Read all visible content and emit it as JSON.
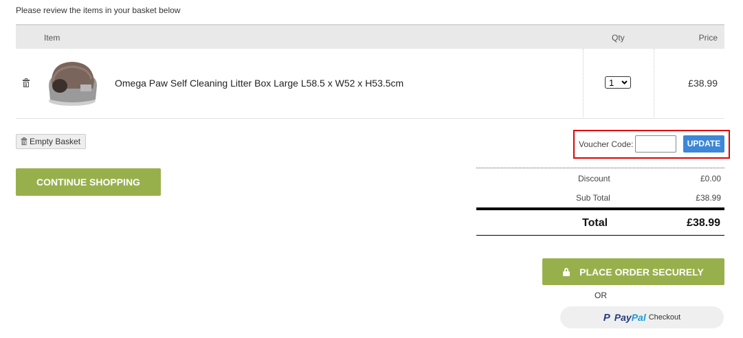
{
  "intro_text": "Please review the items in your basket below",
  "table": {
    "headers": {
      "item": "Item",
      "qty": "Qty",
      "price": "Price"
    },
    "rows": [
      {
        "name": "Omega Paw Self Cleaning Litter Box Large L58.5 x W52 x H53.5cm",
        "qty": "1",
        "price": "£38.99"
      }
    ]
  },
  "buttons": {
    "empty_basket": "Empty Basket",
    "continue_shopping": "CONTINUE SHOPPING",
    "update": "UPDATE",
    "place_order": "PLACE ORDER SECURELY",
    "paypal_checkout": "Checkout"
  },
  "voucher": {
    "label": "Voucher Code:",
    "value": ""
  },
  "totals": {
    "discount_label": "Discount",
    "discount_value": "£0.00",
    "subtotal_label": "Sub Total",
    "subtotal_value": "£38.99",
    "total_label": "Total",
    "total_value": "£38.99"
  },
  "or_text": "OR",
  "paypal": {
    "part1": "Pay",
    "part2": "Pal",
    "mark": "P"
  },
  "colors": {
    "green": "#98b04c",
    "blue": "#3d87d6",
    "highlight": "#e00000"
  },
  "icons": [
    "trash-icon",
    "lock-icon",
    "paypal-logo"
  ]
}
